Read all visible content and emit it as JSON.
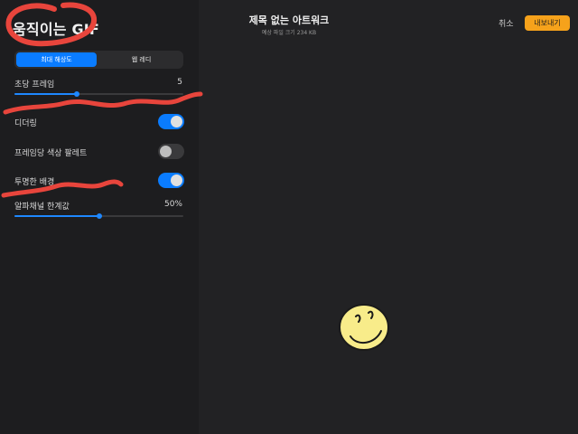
{
  "sidebar": {
    "title": "움직이는 GIF",
    "segment": {
      "options": [
        "최대 해상도",
        "웹 레디"
      ],
      "selected": "최대 해상도"
    },
    "frames_per_second": {
      "label": "초당 프레임",
      "value": "5",
      "level": 0.37
    },
    "dithering": {
      "label": "디더링",
      "on": true
    },
    "per_frame_palette": {
      "label": "프레임당 색상 팔레트",
      "on": false
    },
    "transparent_background": {
      "label": "투명한 배경",
      "on": true
    },
    "alpha_threshold": {
      "label": "알파채널 한계값",
      "value": "50%",
      "level": 0.5
    }
  },
  "header": {
    "title": "제목 없는 아트워크",
    "subtitle": "예상 파일 크기 234 KB",
    "cancel_label": "취소",
    "export_label": "내보내기"
  },
  "colors": {
    "accent": "#0a7cff",
    "export": "#f6a21b",
    "annotation": "#e8453c",
    "sticker": "#f8ec8a"
  },
  "icons": [
    "smiley-sticker-icon"
  ]
}
